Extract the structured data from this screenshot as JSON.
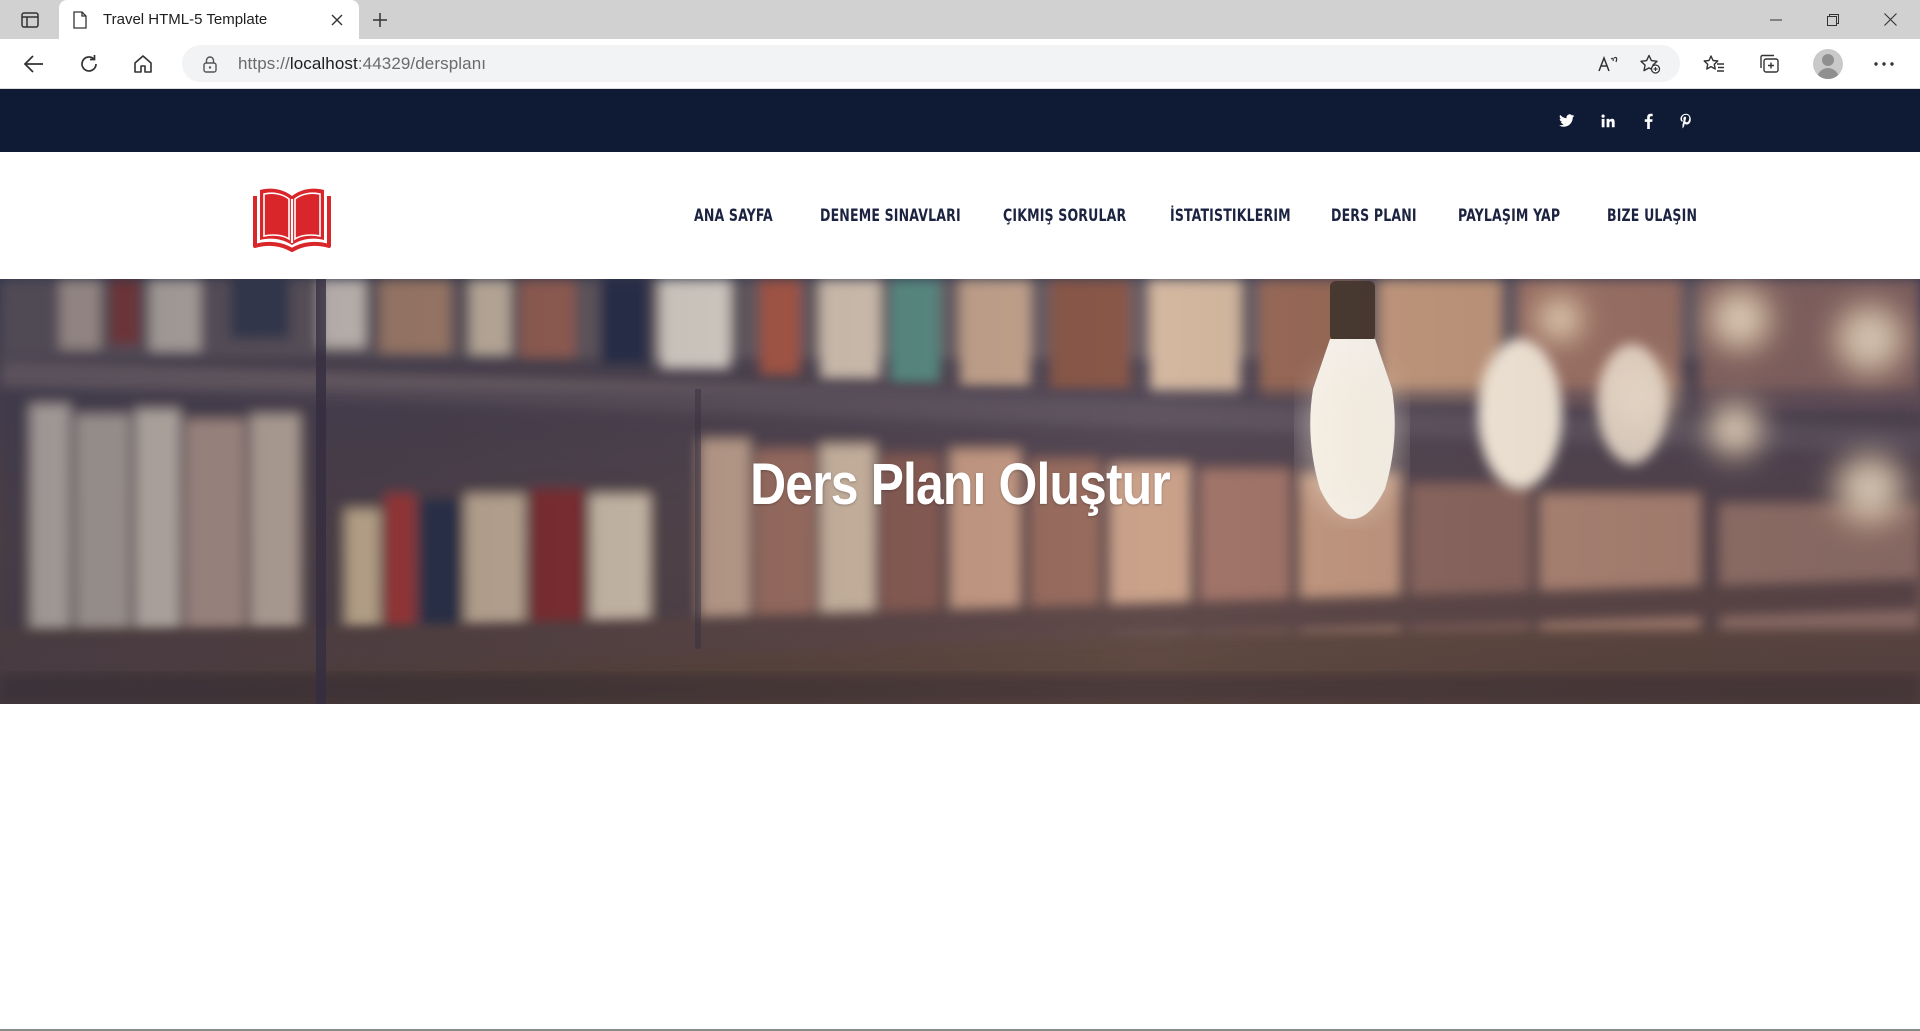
{
  "browser": {
    "tab": {
      "title": "Travel HTML-5 Template"
    },
    "address": {
      "url_prefix": "https://",
      "url_host": "localhost",
      "url_rest": ":44329/dersplanı"
    }
  },
  "topbar": {
    "social": [
      "twitter-icon",
      "linkedin-icon",
      "facebook-icon",
      "pinterest-icon"
    ]
  },
  "header": {
    "logo": "open-book-icon",
    "nav": [
      {
        "label": "ANA SAYFA"
      },
      {
        "label": "DENEME SINAVLARI"
      },
      {
        "label": "ÇIKMIŞ SORULAR"
      },
      {
        "label": "İSTATISTIKLERIM"
      },
      {
        "label": "DERS PLANI"
      },
      {
        "label": "PAYLAŞIM YAP"
      },
      {
        "label": "BIZE ULAŞIN"
      }
    ]
  },
  "hero": {
    "title": "Ders Planı Oluştur"
  },
  "colors": {
    "topbar": "#0f1b34",
    "logo_red": "#d9262a",
    "nav_text": "#1c2340"
  }
}
